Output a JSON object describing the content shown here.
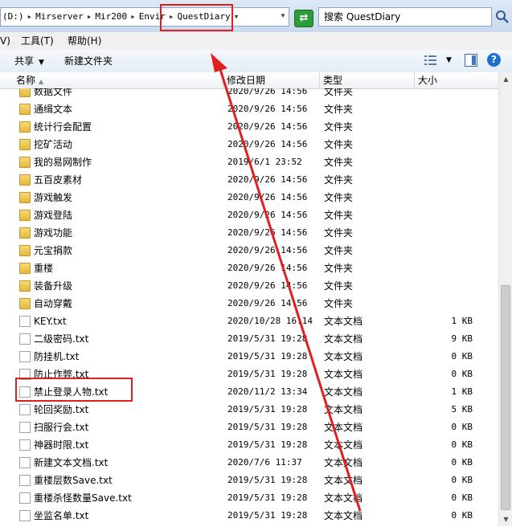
{
  "address": {
    "crumbs": [
      "(D:)",
      "Mirserver",
      "Mir200",
      "Envir",
      "QuestDiary"
    ],
    "separator": "▸",
    "dropdown_glyph": "▾",
    "search_placeholder": "搜索 QuestDiary",
    "refresh_glyph": "⇄"
  },
  "menu": [
    "V)",
    "工具(T)",
    "帮助(H)"
  ],
  "toolbar": {
    "share_label": "共享",
    "new_folder_label": "新建文件夹",
    "dropdown_glyph": "▼",
    "help_glyph": "?"
  },
  "columns": {
    "name": "名称",
    "date": "修改日期",
    "type": "类型",
    "size": "大小",
    "sort_glyph": "▲"
  },
  "files": [
    {
      "name": "数据文件",
      "date": "2020/9/26 14:56",
      "type": "文件夹",
      "size": "",
      "kind": "folder"
    },
    {
      "name": "通缉文本",
      "date": "2020/9/26 14:56",
      "type": "文件夹",
      "size": "",
      "kind": "folder"
    },
    {
      "name": "统计行会配置",
      "date": "2020/9/26 14:56",
      "type": "文件夹",
      "size": "",
      "kind": "folder"
    },
    {
      "name": "挖矿活动",
      "date": "2020/9/26 14:56",
      "type": "文件夹",
      "size": "",
      "kind": "folder"
    },
    {
      "name": "我的易网制作",
      "date": "2019/6/1 23:52",
      "type": "文件夹",
      "size": "",
      "kind": "folder"
    },
    {
      "name": "五百皮素材",
      "date": "2020/9/26 14:56",
      "type": "文件夹",
      "size": "",
      "kind": "folder"
    },
    {
      "name": "游戏触发",
      "date": "2020/9/26 14:56",
      "type": "文件夹",
      "size": "",
      "kind": "folder"
    },
    {
      "name": "游戏登陆",
      "date": "2020/9/26 14:56",
      "type": "文件夹",
      "size": "",
      "kind": "folder"
    },
    {
      "name": "游戏功能",
      "date": "2020/9/26 14:56",
      "type": "文件夹",
      "size": "",
      "kind": "folder"
    },
    {
      "name": "元宝捐款",
      "date": "2020/9/26 14:56",
      "type": "文件夹",
      "size": "",
      "kind": "folder"
    },
    {
      "name": "重楼",
      "date": "2020/9/26 14:56",
      "type": "文件夹",
      "size": "",
      "kind": "folder"
    },
    {
      "name": "装备升级",
      "date": "2020/9/26 14:56",
      "type": "文件夹",
      "size": "",
      "kind": "folder"
    },
    {
      "name": "自动穿戴",
      "date": "2020/9/26 14:56",
      "type": "文件夹",
      "size": "",
      "kind": "folder"
    },
    {
      "name": "KEY.txt",
      "date": "2020/10/28 16:14",
      "type": "文本文档",
      "size": "1 KB",
      "kind": "file"
    },
    {
      "name": "二级密码.txt",
      "date": "2019/5/31 19:28",
      "type": "文本文档",
      "size": "9 KB",
      "kind": "file"
    },
    {
      "name": "防挂机.txt",
      "date": "2019/5/31 19:28",
      "type": "文本文档",
      "size": "0 KB",
      "kind": "file"
    },
    {
      "name": "防止作弊.txt",
      "date": "2019/5/31 19:28",
      "type": "文本文档",
      "size": "0 KB",
      "kind": "file"
    },
    {
      "name": "禁止登录人物.txt",
      "date": "2020/11/2 13:34",
      "type": "文本文档",
      "size": "1 KB",
      "kind": "file"
    },
    {
      "name": "轮回奖励.txt",
      "date": "2019/5/31 19:28",
      "type": "文本文档",
      "size": "5 KB",
      "kind": "file"
    },
    {
      "name": "扫服行会.txt",
      "date": "2019/5/31 19:28",
      "type": "文本文档",
      "size": "0 KB",
      "kind": "file"
    },
    {
      "name": "神器时限.txt",
      "date": "2019/5/31 19:28",
      "type": "文本文档",
      "size": "0 KB",
      "kind": "file"
    },
    {
      "name": "新建文本文档.txt",
      "date": "2020/7/6 11:37",
      "type": "文本文档",
      "size": "0 KB",
      "kind": "file"
    },
    {
      "name": "重楼层数Save.txt",
      "date": "2019/5/31 19:28",
      "type": "文本文档",
      "size": "0 KB",
      "kind": "file"
    },
    {
      "name": "重楼杀怪数量Save.txt",
      "date": "2019/5/31 19:28",
      "type": "文本文档",
      "size": "0 KB",
      "kind": "file"
    },
    {
      "name": "坐监名单.txt",
      "date": "2019/5/31 19:28",
      "type": "文本文档",
      "size": "0 KB",
      "kind": "file"
    }
  ],
  "scrollbar": {
    "up_glyph": "▲",
    "down_glyph": "▼"
  },
  "annotation": {
    "color": "#e02020"
  }
}
